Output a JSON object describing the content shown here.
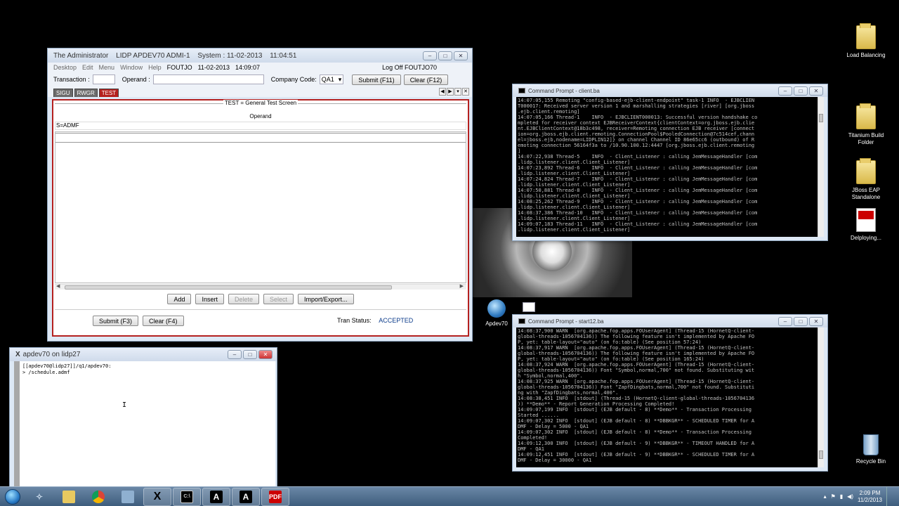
{
  "desktop": {
    "icons": [
      {
        "label": "Load Balancing"
      },
      {
        "label": "Titanium Build Folder"
      },
      {
        "label": "JBoss EAP Standalone"
      },
      {
        "label": "Delploying..."
      },
      {
        "label": "Recycle Bin"
      },
      {
        "label": "Apdev70"
      }
    ]
  },
  "app": {
    "title_parts": [
      "The Administrator",
      "LIDP APDEV70 ADMI-1",
      "System : 11-02-2013",
      "11:04:51"
    ],
    "menu": [
      "Desktop",
      "Edit",
      "Menu",
      "Window",
      "Help"
    ],
    "user": "FOUTJO",
    "date": "11-02-2013",
    "time": "14:09:07",
    "logoff": "Log Off FOUTJO70",
    "transaction_label": "Transaction :",
    "transaction_value": "",
    "operand_label": "Operand :",
    "operand_value": "",
    "company_label": "Company Code:",
    "company_value": "QA1",
    "submit_top": "Submit (F11)",
    "clear_top": "Clear (F12)",
    "tabs": [
      "SIGU",
      "RWGR",
      "TEST"
    ],
    "group_title": "TEST = General Test Screen",
    "column_header": "Operand",
    "row_value": "S=ADMF",
    "buttons": {
      "add": "Add",
      "insert": "Insert",
      "delete": "Delete",
      "select": "Select",
      "import": "Import/Export..."
    },
    "submit_bottom": "Submit (F3)",
    "clear_bottom": "Clear (F4)",
    "tran_status_label": "Tran Status:",
    "tran_status_value": "ACCEPTED"
  },
  "xterm": {
    "title": "apdev70 on lidp27",
    "lines": [
      "[[apdev70@lidp27]]/q1/apdev70:",
      "> /schedule.admf"
    ]
  },
  "cmd1": {
    "title": "Command Prompt - client.ba",
    "lines": [
      "14:07:05,155 Remoting \"config-based-ejb-client-endpoint\" task-1 INFO  - EJBCLIEN",
      "T000017: Received server version 1 and marshalling strategies [river] [org.jboss",
      ".ejb.client.remoting]",
      "14:07:05,166 Thread-1    INFO  - EJBCLIENT000013: Successful version handshake co",
      "mpleted for receiver context EJBReceiverContext{clientContext=org.jboss.ejb.clie",
      "nt.EJBClientContext@18b3c498, receiver=Remoting connection EJB receiver [connect",
      "ion=org.jboss.ejb.client.remoting.ConnectionPool$PooledConnection@7c514cef,chann",
      "el=jboss.ejb,nodename=LIDPLIN12]} on channel Channel ID 86e65cc6 (outbound) of R",
      "emoting connection 56164f3a to /10.90.100.12:4447 [org.jboss.ejb.client.remoting",
      "]",
      "14:07:22,938 Thread-5    INFO  - Client_Listener : calling JemMessageHandler [com",
      ".lidp.listener.client.Client_Listener]",
      "14:07:23,892 Thread-6    INFO  - Client_Listener : calling JemMessageHandler [com",
      ".lidp.listener.client.Client_Listener]",
      "14:07:24,824 Thread-7    INFO  - Client_Listener : calling JemMessageHandler [com",
      ".lidp.listener.client.Client_Listener]",
      "14:07:50,881 Thread-8    INFO  - Client_Listener : calling JemMessageHandler [com",
      ".lidp.listener.client.Client_Listener]",
      "14:08:25,262 Thread-9    INFO  - Client_Listener : calling JemMessageHandler [com",
      ".lidp.listener.client.Client_Listener]",
      "14:08:37,386 Thread-10   INFO  - Client_Listener : calling JemMessageHandler [com",
      ".lidp.listener.client.Client_Listener]",
      "14:09:07,183 Thread-11   INFO  - Client_Listener : calling JemMessageHandler [com",
      ".lidp.listener.client.Client_Listener]"
    ]
  },
  "cmd2": {
    "title": "Command Prompt - start12.ba",
    "lines": [
      "14:08:37,900 WARN  [org.apache.fop.apps.FOUserAgent] (Thread-15 (HornetQ-client-",
      "global-threads-1056704136)) The following feature isn't implemented by Apache FO",
      "P, yet: table-layout=\"auto\" (on fo:table) (See position 57:24)",
      "14:08:37,917 WARN  [org.apache.fop.apps.FOUserAgent] (Thread-15 (HornetQ-client-",
      "global-threads-1056704136)) The following feature isn't implemented by Apache FO",
      "P, yet: table-layout=\"auto\" (on fo:table) (See position 165:24)",
      "14:08:37,924 WARN  [org.apache.fop.apps.FOUserAgent] (Thread-15 (HornetQ-client-",
      "global-threads-1056704136)) Font \"Symbol,normal,700\" not found. Substituting wit",
      "h \"Symbol,normal,400\".",
      "14:08:37,925 WARN  [org.apache.fop.apps.FOUserAgent] (Thread-15 (HornetQ-client-",
      "global-threads-1056704136)) Font \"ZapfDingbats,normal,700\" not found. Substituti",
      "ng with \"ZapfDingbats,normal,400\".",
      "14:08:38,451 INFO  [stdout] (Thread-15 (HornetQ-client-global-threads-1056704136",
      ")) **Demo** - Report Generation Processing Completed!",
      "14:09:07,199 INFO  [stdout] (EJB default - 8) **Demo** - Transaction Processing",
      "Started ......",
      "14:09:07,302 INFO  [stdout] (EJB default - 8) **DBBKGR** - SCHEDULED TIMER for A",
      "DMF - Delay = 5000 - QA1",
      "14:09:07,302 INFO  [stdout] (EJB default - 8) **Demo** - Transaction Processing",
      "Completed!",
      "14:09:12,300 INFO  [stdout] (EJB default - 9) **DBBKGR** - TIMEOUT HANDLED for A",
      "DMF - QA1",
      "14:09:12,451 INFO  [stdout] (EJB default - 9) **DBBKGR** - SCHEDULED TIMER for A",
      "DMF - Delay = 30000 - QA1"
    ]
  },
  "taskbar": {
    "time": "2:09 PM",
    "date": "11/2/2013",
    "items": [
      "search-app-icon",
      "folder-icon",
      "chrome-icon",
      "network-icon",
      "x-server-icon",
      "cmd-icon",
      "app-a-icon",
      "app-a2-icon",
      "pdf-icon"
    ]
  }
}
